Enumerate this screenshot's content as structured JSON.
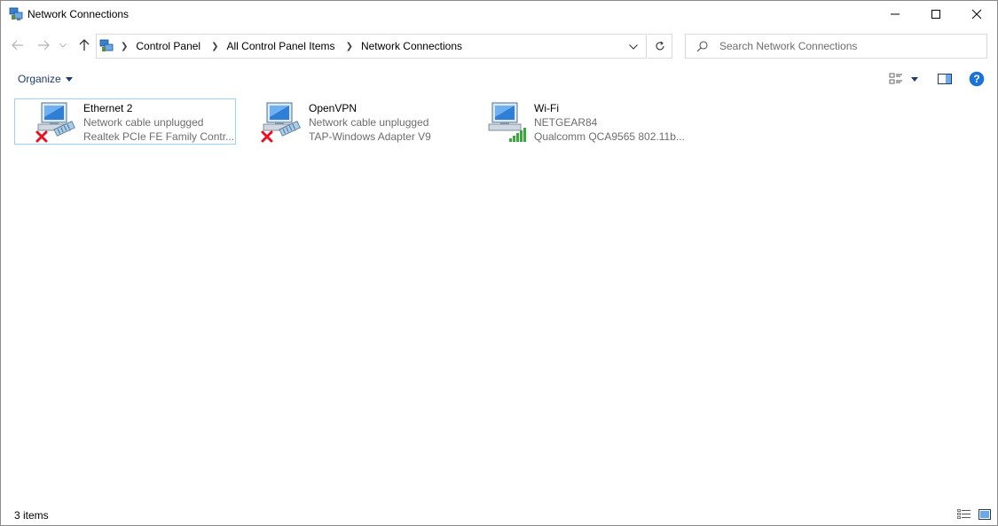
{
  "window": {
    "title": "Network Connections",
    "controls": {
      "minimize": "minimize-icon",
      "maximize": "maximize-icon",
      "close": "close-icon"
    }
  },
  "navigation": {
    "back": "back-arrow-icon",
    "forward": "forward-arrow-icon",
    "up": "up-arrow-icon",
    "breadcrumbs": [
      "Control Panel",
      "All Control Panel Items",
      "Network Connections"
    ],
    "refresh": "refresh-icon"
  },
  "search": {
    "placeholder": "Search Network Connections",
    "value": ""
  },
  "toolbar": {
    "organize_label": "Organize"
  },
  "connections": [
    {
      "name": "Ethernet 2",
      "status": "Network cable unplugged",
      "device": "Realtek PCIe FE Family Contr...",
      "icon": "ethernet-disconnected-icon",
      "selected": true
    },
    {
      "name": "OpenVPN",
      "status": "Network cable unplugged",
      "device": "TAP-Windows Adapter V9",
      "icon": "ethernet-disconnected-icon",
      "selected": false
    },
    {
      "name": "Wi-Fi",
      "status": "NETGEAR84",
      "device": "Qualcomm QCA9565 802.11b...",
      "icon": "wifi-connected-icon",
      "selected": false
    }
  ],
  "status_bar": {
    "item_count": "3 items"
  },
  "colors": {
    "selection_border": "#99d1ff",
    "secondary_text": "#6d6d6d",
    "help_blue": "#1a73d9",
    "error_red": "#e81123",
    "signal_green": "#3aa83a"
  }
}
